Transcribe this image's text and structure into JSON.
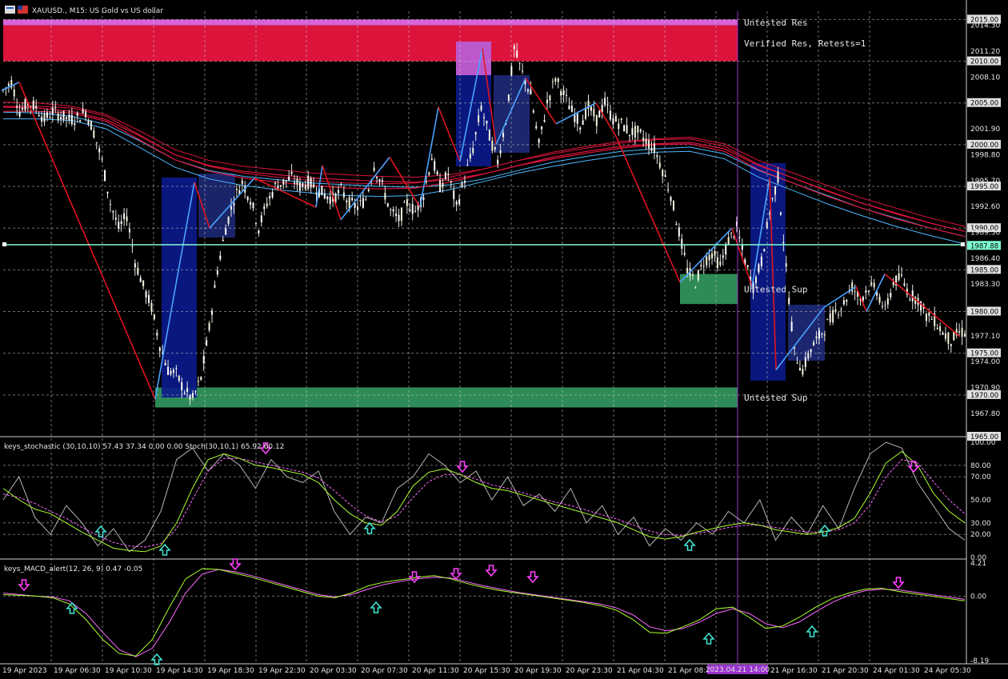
{
  "symbol_title": "XAUUSD., M15: US Gold vs US dollar",
  "stochastic_title": "keys_stochastic (30,10,10) 57.43 37.34 0.00 0.00 Stoch(30,10,1) 65.92 60.12",
  "macd_title": "keys_MACD_alert(12, 26, 9) 0.47 -0.05",
  "crosshair_time_label": "2023.04.21 14:00",
  "current_price_label": "1987.88",
  "zones": [
    {
      "label": "Untested Res",
      "price_low": 2014.3,
      "price_high": 2015.0,
      "color": "#d864d8"
    },
    {
      "label": "Verified Res, Retests=1",
      "price_low": 2010.0,
      "price_high": 2014.3,
      "color": "#dc143c"
    },
    {
      "label": "Untested Sup",
      "price_low": 1980.9,
      "price_high": 1984.5,
      "color": "#2e8b57"
    },
    {
      "label": "Untested Sup",
      "price_low": 1968.5,
      "price_high": 1970.9,
      "color": "#2e8b57"
    }
  ],
  "colors": {
    "background": "#000000",
    "bull_candle": "#ffffff",
    "bear_candle": "#ffffff",
    "ma_red": "#dc143c",
    "ma_blue": "#4db8ff",
    "current_price_line": "#7fffd4",
    "stoch_main": "#b4b4b4",
    "stoch_signal": "#ff69ff",
    "stoch_fast": "#adff2f",
    "arrow_up": "#40e0d0",
    "arrow_down": "#ff40ff",
    "crosshair": "#9932cc"
  },
  "chart_data": [
    {
      "type": "candlestick",
      "title": "XAUUSD., M15: US Gold vs US dollar",
      "ylim": [
        1965.0,
        2016.0
      ],
      "y_ticks": [
        "2015.00",
        "2014.30",
        "2011.20",
        "2010.00",
        "2008.10",
        "2005.00",
        "2001.90",
        "2000.00",
        "1998.80",
        "1995.70",
        "1995.00",
        "1992.60",
        "1990.00",
        "1989.50",
        "1987.88",
        "1986.40",
        "1985.00",
        "1983.30",
        "1980.00",
        "1977.10",
        "1975.00",
        "1974.00",
        "1970.90",
        "1970.00",
        "1967.80",
        "1965.00"
      ],
      "x_ticks": [
        "19 Apr 2023",
        "19 Apr 06:30",
        "19 Apr 10:30",
        "19 Apr 14:30",
        "19 Apr 18:30",
        "19 Apr 22:30",
        "20 Apr 03:30",
        "20 Apr 07:30",
        "20 Apr 11:30",
        "20 Apr 15:30",
        "20 Apr 19:30",
        "20 Apr 23:30",
        "21 Apr 04:30",
        "21 Apr 08:30",
        "21 Apr 16:30",
        "21 Apr 20:30",
        "24 Apr 01:30",
        "24 Apr 05:30"
      ],
      "close_path": [
        2006.5,
        2007.5,
        2004.0,
        2005.0,
        2004.5,
        2003.0,
        2004.0,
        2003.5,
        2003.0,
        2003.2,
        2004.0,
        2001.5,
        1998.0,
        1993.0,
        1990.0,
        1991.5,
        1986.0,
        1983.0,
        1980.5,
        1976.0,
        1973.0,
        1972.5,
        1970.5,
        1969.5,
        1972.0,
        1978.0,
        1985.0,
        1990.0,
        1993.5,
        1995.5,
        1993.5,
        1990.0,
        1993.0,
        1995.0,
        1995.5,
        1996.0,
        1995.0,
        1995.5,
        1994.8,
        1994.0,
        1993.5,
        1994.5,
        1993.0,
        1992.5,
        1993.5,
        1997.5,
        1995.0,
        1992.0,
        1991.0,
        1993.0,
        1992.0,
        1994.0,
        1998.5,
        1995.0,
        1996.5,
        1992.5,
        1996.0,
        1999.5,
        2004.5,
        2001.0,
        1998.0,
        2003.0,
        2011.5,
        2008.5,
        2006.0,
        2000.0,
        2005.0,
        2008.0,
        2006.0,
        2004.0,
        2002.5,
        2004.5,
        2003.0,
        2005.0,
        2003.0,
        2002.5,
        2001.5,
        2001.5,
        2000.5,
        1999.5,
        1997.0,
        1994.0,
        1989.5,
        1985.0,
        1983.5,
        1986.0,
        1987.0,
        1985.5,
        1988.5,
        1990.0,
        1986.0,
        1983.0,
        1986.0,
        1992.0,
        1996.0,
        1985.0,
        1975.0,
        1973.0,
        1975.5,
        1977.0,
        1978.5,
        1980.0,
        1981.0,
        1983.0,
        1981.5,
        1983.0,
        1982.5,
        1980.0,
        1983.5,
        1984.0,
        1982.0,
        1981.5,
        1979.5,
        1979.0,
        1977.5,
        1976.5,
        1977.5
      ],
      "current_price": 1987.88,
      "series": [
        {
          "name": "",
          "type": "moving_average",
          "values": [
            2004.5,
            2004.4,
            2004.0,
            2003.0,
            2001.0,
            1998.8,
            1997.5,
            1996.8,
            1996.4,
            1996.0,
            1995.8,
            1995.6,
            1995.5,
            1995.8,
            1996.5,
            1997.5,
            1998.5,
            1999.2,
            1999.8,
            2000.1,
            2000.3,
            1999.5,
            1997.5,
            1996.0,
            1994.5,
            1993.0,
            1991.8,
            1990.6,
            1989.6
          ]
        },
        {
          "name": "",
          "type": "moving_average",
          "values": [
            2004.0,
            2004.0,
            2003.8,
            2002.8,
            2000.5,
            1998.2,
            1996.8,
            1996.0,
            1995.5,
            1995.1,
            1994.8,
            1994.7,
            1994.8,
            1995.5,
            1996.5,
            1997.5,
            1998.3,
            1999.0,
            1999.6,
            2000.0,
            2000.1,
            1999.2,
            1997.0,
            1995.4,
            1993.8,
            1992.4,
            1991.1,
            1990.0,
            1989.0
          ]
        }
      ],
      "annotations": [
        "Untested Res",
        "Verified Res, Retests=1",
        "Untested Sup",
        "Untested Sup"
      ]
    },
    {
      "type": "line",
      "title": "keys_stochastic (30,10,10) 57.43 37.34 0.00 0.00 Stoch(30,10,1) 65.92 60.12",
      "ylim": [
        0,
        100
      ],
      "y_ticks": [
        "100.00",
        "80.00",
        "70.00",
        "50.00",
        "30.00",
        "20.00",
        "0.00"
      ],
      "series": [
        {
          "name": "",
          "values": [
            60,
            50,
            42,
            38,
            30,
            22,
            15,
            8,
            6,
            5,
            10,
            30,
            60,
            85,
            90,
            86,
            80,
            78,
            75,
            72,
            65,
            50,
            38,
            30,
            28,
            40,
            62,
            74,
            77,
            72,
            65,
            60,
            58,
            54,
            50,
            46,
            42,
            38,
            34,
            30,
            24,
            18,
            16,
            18,
            22,
            25,
            28,
            30,
            28,
            24,
            22,
            20,
            22,
            26,
            34,
            56,
            82,
            92,
            80,
            56,
            40,
            30
          ]
        },
        {
          "name": "",
          "values": [
            55,
            52,
            47,
            40,
            34,
            26,
            19,
            13,
            10,
            9,
            12,
            25,
            50,
            75,
            86,
            86,
            83,
            80,
            77,
            74,
            69,
            58,
            46,
            36,
            31,
            36,
            52,
            66,
            72,
            72,
            68,
            63,
            60,
            56,
            52,
            48,
            45,
            41,
            37,
            33,
            28,
            23,
            20,
            19,
            21,
            23,
            26,
            28,
            28,
            26,
            24,
            22,
            22,
            24,
            30,
            46,
            70,
            85,
            82,
            66,
            50,
            38
          ]
        },
        {
          "name": "",
          "values": [
            50,
            70,
            35,
            20,
            45,
            30,
            10,
            25,
            5,
            15,
            40,
            85,
            95,
            75,
            90,
            80,
            60,
            85,
            70,
            65,
            75,
            40,
            20,
            35,
            30,
            60,
            70,
            90,
            80,
            65,
            75,
            50,
            70,
            45,
            55,
            40,
            60,
            30,
            45,
            20,
            35,
            10,
            25,
            15,
            30,
            20,
            40,
            30,
            50,
            15,
            35,
            20,
            45,
            25,
            60,
            90,
            100,
            95,
            65,
            45,
            25,
            15
          ]
        }
      ]
    },
    {
      "type": "line",
      "title": "keys_MACD_alert(12, 26, 9) 0.47 -0.05",
      "ylim": [
        -8.19,
        4.21
      ],
      "y_ticks": [
        "4.21",
        "0.00",
        "-8.19"
      ],
      "series": [
        {
          "name": "",
          "values": [
            0.2,
            0.1,
            0.0,
            -0.2,
            -1.0,
            -3.0,
            -5.5,
            -7.3,
            -7.6,
            -5.5,
            -1.5,
            2.2,
            3.5,
            3.4,
            2.9,
            2.4,
            1.8,
            1.2,
            0.6,
            0.0,
            -0.2,
            0.4,
            1.3,
            1.8,
            2.1,
            2.4,
            2.6,
            2.2,
            1.6,
            1.1,
            0.7,
            0.4,
            0.1,
            -0.2,
            -0.5,
            -0.8,
            -1.2,
            -1.8,
            -3.0,
            -4.6,
            -4.7,
            -3.9,
            -3.0,
            -1.6,
            -1.4,
            -2.7,
            -4.1,
            -3.8,
            -2.7,
            -1.4,
            -0.3,
            0.4,
            0.9,
            1.0,
            0.6,
            0.3,
            0.0,
            -0.3,
            -0.6
          ]
        },
        {
          "name": "",
          "values": [
            0.4,
            0.2,
            0.0,
            -0.1,
            -0.6,
            -2.2,
            -4.6,
            -6.8,
            -7.7,
            -6.6,
            -3.4,
            0.4,
            2.8,
            3.4,
            3.1,
            2.6,
            2.0,
            1.4,
            0.8,
            0.2,
            -0.1,
            0.2,
            0.9,
            1.5,
            1.9,
            2.2,
            2.4,
            2.3,
            1.8,
            1.3,
            0.9,
            0.5,
            0.2,
            -0.1,
            -0.4,
            -0.7,
            -1.0,
            -1.5,
            -2.4,
            -3.9,
            -4.4,
            -4.1,
            -3.3,
            -2.2,
            -1.6,
            -2.2,
            -3.5,
            -4.0,
            -3.3,
            -2.0,
            -0.8,
            0.1,
            0.7,
            0.9,
            0.8,
            0.5,
            0.2,
            -0.1,
            -0.4
          ]
        }
      ]
    }
  ]
}
